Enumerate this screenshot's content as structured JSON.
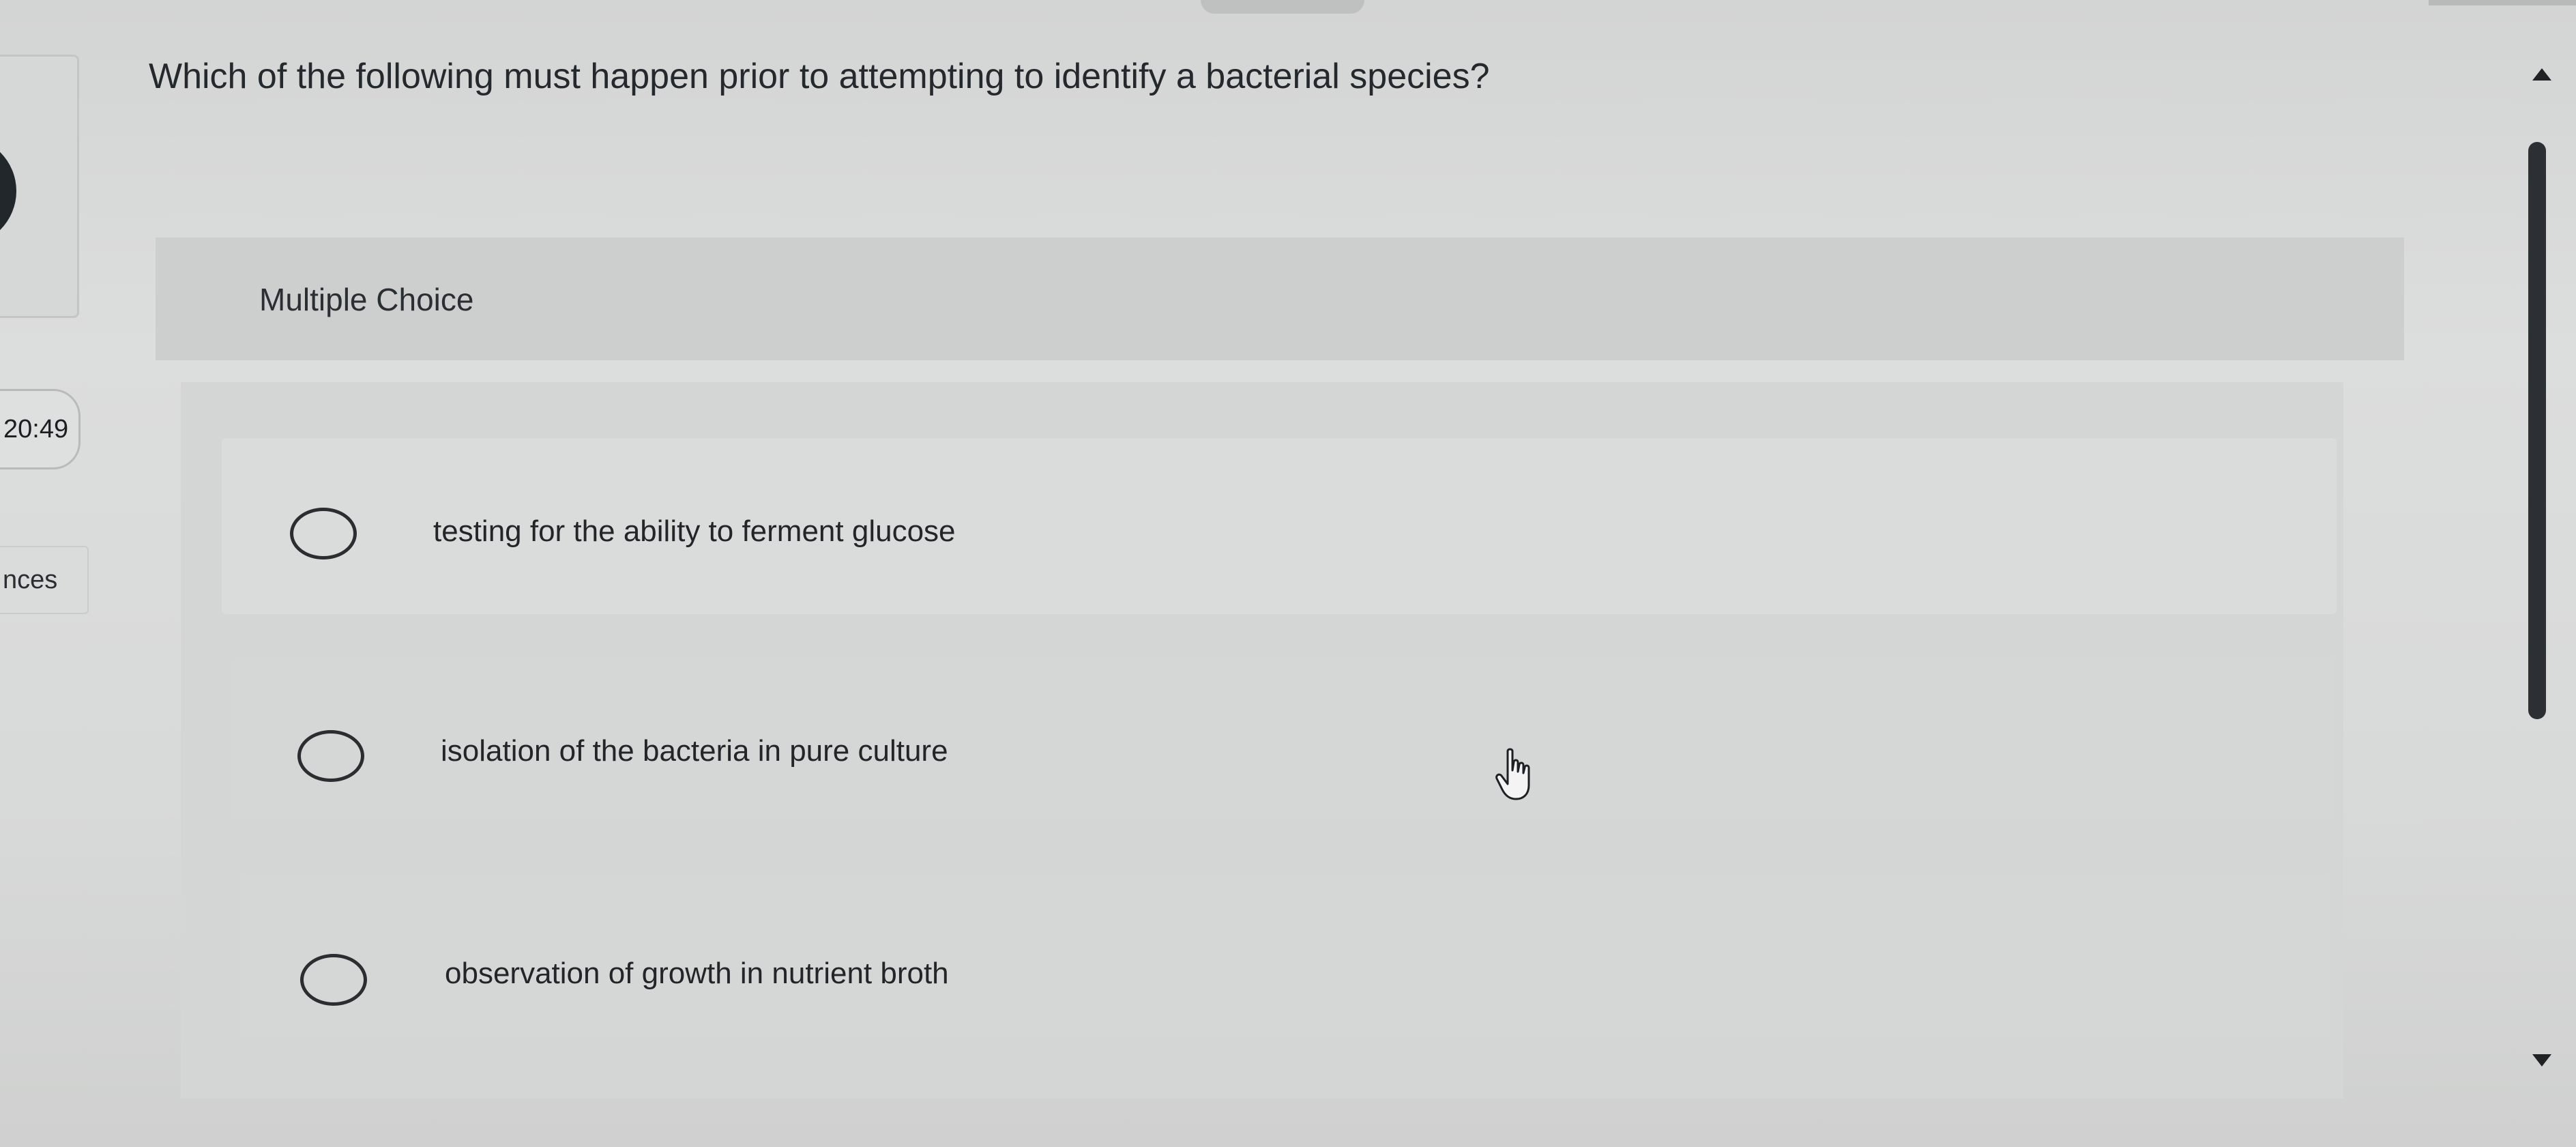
{
  "question": {
    "text": "Which of the following must happen prior to attempting to identify a bacterial species?"
  },
  "question_type": {
    "label": "Multiple Choice"
  },
  "timer": {
    "value": "20:49"
  },
  "left_rail": {
    "link_label": "nces"
  },
  "options": [
    {
      "label": "testing for the ability to ferment glucose",
      "selected": false
    },
    {
      "label": "isolation of the bacteria in pure culture",
      "selected": false
    },
    {
      "label": "observation of growth in nutrient broth",
      "selected": false
    }
  ],
  "icons": {
    "scroll_up": "triangle-up-icon",
    "scroll_down": "triangle-down-icon",
    "cursor": "hand-pointer-icon",
    "radio": "radio-circle-icon"
  },
  "colors": {
    "text": "#24292d",
    "scroll_thumb": "#2c3034",
    "background": "#d9dada"
  }
}
